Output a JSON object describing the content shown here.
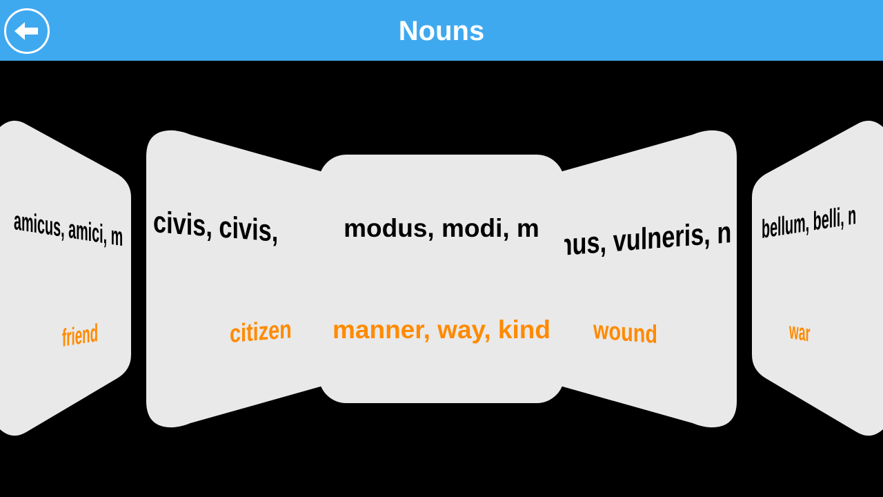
{
  "header": {
    "title": "Nouns",
    "back_icon": "back-arrow-icon"
  },
  "colors": {
    "header_bg": "#3fa9f0",
    "card_bg": "#e9e9e9",
    "word": "#000000",
    "meaning": "#ff8a00"
  },
  "cards": [
    {
      "word": "amicus, amici, m",
      "meaning": "friend"
    },
    {
      "word": "civis, civis, m and",
      "meaning": "citizen"
    },
    {
      "word": "modus, modi, m",
      "meaning": "manner, way, kind"
    },
    {
      "word": "vulnus, vulneris, n",
      "meaning": "wound"
    },
    {
      "word": "bellum, belli, n",
      "meaning": "war"
    }
  ]
}
